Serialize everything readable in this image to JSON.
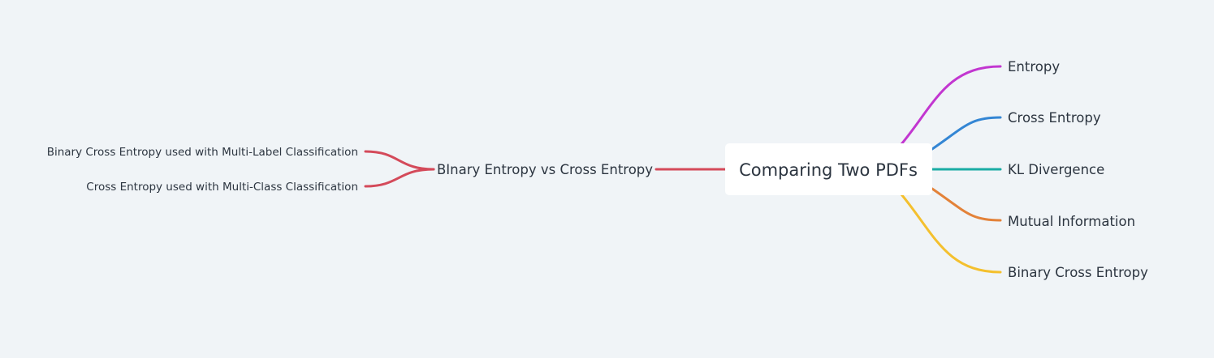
{
  "root": {
    "label": "Comparing Two PDFs"
  },
  "right_branches": [
    {
      "label": "Entropy",
      "color": "#c236d0"
    },
    {
      "label": "Cross Entropy",
      "color": "#3486d4"
    },
    {
      "label": "KL Divergence",
      "color": "#1aaca4"
    },
    {
      "label": "Mutual Information",
      "color": "#e38239"
    },
    {
      "label": "Binary Cross Entropy",
      "color": "#f4c02e"
    }
  ],
  "left_branch": {
    "label": "BInary Entropy vs Cross Entropy",
    "color": "#d44a5a",
    "children": [
      {
        "label": "Binary Cross Entropy used with Multi-Label Classification"
      },
      {
        "label": "Cross Entropy used with Multi-Class Classification"
      }
    ]
  }
}
